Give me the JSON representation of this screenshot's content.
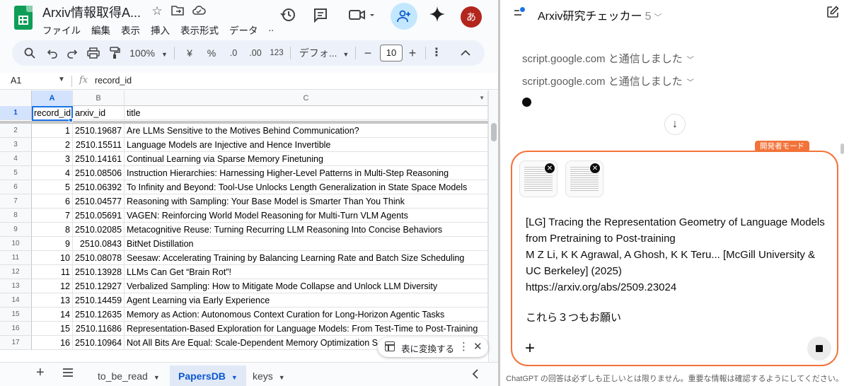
{
  "sheets": {
    "doc_title": "Arxiv情報取得A...",
    "menu": [
      "ファイル",
      "編集",
      "表示",
      "挿入",
      "表示形式",
      "データ",
      ".."
    ],
    "avatar": "あ",
    "toolbar": {
      "zoom": "100%",
      "currency": "¥",
      "percent": "%",
      "dec_decrease": ".0",
      "dec_increase": ".00",
      "format_123": "123",
      "font": "デフォ...",
      "minus": "−",
      "font_size": "10",
      "plus": "+"
    },
    "namebox": "A1",
    "formula_value": "record_id",
    "columns": [
      "A",
      "B",
      "C"
    ],
    "header_row": {
      "num": "1",
      "a": "record_id",
      "b": "arxiv_id",
      "c": "title"
    },
    "rows": [
      {
        "num": "2",
        "a": "1",
        "b": "2510.19687",
        "c": "Are LLMs Sensitive to the Motives Behind Communication?"
      },
      {
        "num": "3",
        "a": "2",
        "b": "2510.15511",
        "c": "Language Models are Injective and Hence Invertible"
      },
      {
        "num": "4",
        "a": "3",
        "b": "2510.14161",
        "c": "Continual Learning via Sparse Memory Finetuning"
      },
      {
        "num": "5",
        "a": "4",
        "b": "2510.08506",
        "c": "Instruction Hierarchies: Harnessing Higher-Level Patterns in Multi-Step Reasoning"
      },
      {
        "num": "6",
        "a": "5",
        "b": "2510.06392",
        "c": "To Infinity and Beyond: Tool-Use Unlocks Length Generalization in State Space Models"
      },
      {
        "num": "7",
        "a": "6",
        "b": "2510.04577",
        "c": "Reasoning with Sampling: Your Base Model is Smarter Than You Think"
      },
      {
        "num": "8",
        "a": "7",
        "b": "2510.05691",
        "c": "VAGEN: Reinforcing World Model Reasoning for Multi-Turn VLM Agents"
      },
      {
        "num": "9",
        "a": "8",
        "b": "2510.02085",
        "c": "Metacognitive Reuse: Turning Recurring LLM Reasoning Into Concise Behaviors"
      },
      {
        "num": "10",
        "a": "9",
        "b": "2510.0843",
        "c": "BitNet Distillation"
      },
      {
        "num": "11",
        "a": "10",
        "b": "2510.08078",
        "c": "Seesaw: Accelerating Training by Balancing Learning Rate and Batch Size Scheduling"
      },
      {
        "num": "12",
        "a": "11",
        "b": "2510.13928",
        "c": "LLMs Can Get “Brain Rot”!"
      },
      {
        "num": "13",
        "a": "12",
        "b": "2510.12927",
        "c": "Verbalized Sampling: How to Mitigate Mode Collapse and Unlock LLM Diversity"
      },
      {
        "num": "14",
        "a": "13",
        "b": "2510.14459",
        "c": "Agent Learning via Early Experience"
      },
      {
        "num": "15",
        "a": "14",
        "b": "2510.12635",
        "c": "Memory as Action: Autonomous Context Curation for Long-Horizon Agentic Tasks"
      },
      {
        "num": "16",
        "a": "15",
        "b": "2510.11686",
        "c": "Representation-Based Exploration for Language Models: From Test-Time to Post-Training"
      },
      {
        "num": "17",
        "a": "16",
        "b": "2510.10964",
        "c": "Not All Bits Are Equal: Scale-Dependent Memory Optimization S"
      }
    ],
    "convert_chip": "表に変換する",
    "tabs": [
      "to_be_read",
      "PapersDB",
      "keys"
    ],
    "active_tab": "PapersDB"
  },
  "chat": {
    "project": "Arxiv研究チェッカー",
    "project_version": "5",
    "sent_lines": [
      "script.google.com と通信しました",
      "script.google.com と通信しました"
    ],
    "dev_mode_tag": "開発者モード",
    "message_lines": [
      "[LG] Tracing the Representation Geometry of Language Models",
      "from Pretraining to Post-training",
      "M Z Li, K K Agrawal, A Ghosh, K K Teru... [McGill University &",
      "UC Berkeley] (2025)",
      "https://arxiv.org/abs/2509.23024"
    ],
    "message_request": "これら３つもお願い",
    "disclaimer": "ChatGPT の回答は必ずしも正しいとは限りません。重要な情報は確認するようにしてください。"
  },
  "colors": {
    "sheets_green": "#0f9d58",
    "selection_blue": "#1a73e8",
    "share_bg": "#c2e7ff",
    "dev_orange": "#f2733a"
  },
  "icons": [
    "sheets-logo-icon",
    "star-icon",
    "folder-move-icon",
    "cloud-icon",
    "history-icon",
    "comment-icon",
    "video-icon",
    "share-icon",
    "gemini-icon",
    "search-icon",
    "undo-icon",
    "redo-icon",
    "print-icon",
    "paint-format-icon",
    "sidebar-icon",
    "edit-icon",
    "arrow-down-icon",
    "close-icon",
    "plus-icon",
    "stop-icon"
  ]
}
